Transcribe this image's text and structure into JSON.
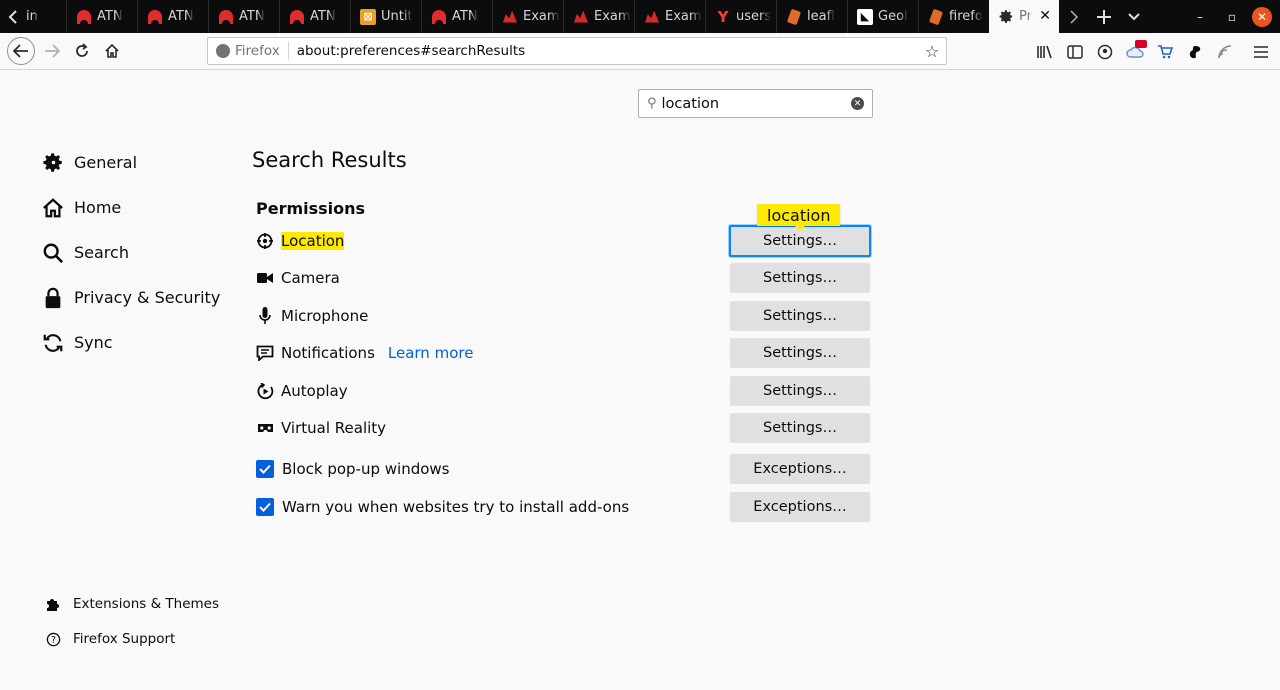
{
  "tabs": [
    {
      "label": "in",
      "icon": "chevron-left-icon"
    },
    {
      "label": "ATN",
      "icon": "huawei-icon"
    },
    {
      "label": "ATN",
      "icon": "huawei-icon"
    },
    {
      "label": "ATN",
      "icon": "huawei-icon"
    },
    {
      "label": "ATN",
      "icon": "huawei-icon"
    },
    {
      "label": "Untit",
      "icon": "untitled-icon"
    },
    {
      "label": "ATN",
      "icon": "huawei-icon"
    },
    {
      "label": "Exam",
      "icon": "exam-icon"
    },
    {
      "label": "Exam",
      "icon": "exam-icon"
    },
    {
      "label": "Exam",
      "icon": "exam-icon"
    },
    {
      "label": "users",
      "icon": "y-icon"
    },
    {
      "label": "leafl",
      "icon": "leaf-icon"
    },
    {
      "label": "Geol",
      "icon": "geo-icon"
    },
    {
      "label": "firefo",
      "icon": "leaf-icon"
    },
    {
      "label": "Pr",
      "icon": "gear-icon"
    }
  ],
  "urlbar": {
    "identity": "Firefox",
    "url": "about:preferences#searchResults"
  },
  "search": {
    "value": "location"
  },
  "sidebar": {
    "items": [
      {
        "label": "General",
        "icon": "gear-icon"
      },
      {
        "label": "Home",
        "icon": "home-icon"
      },
      {
        "label": "Search",
        "icon": "search-icon"
      },
      {
        "label": "Privacy & Security",
        "icon": "lock-icon"
      },
      {
        "label": "Sync",
        "icon": "sync-icon"
      }
    ],
    "footer": [
      {
        "label": "Extensions & Themes",
        "icon": "puzzle-icon"
      },
      {
        "label": "Firefox Support",
        "icon": "help-icon"
      }
    ]
  },
  "main": {
    "title": "Search Results",
    "section": "Permissions",
    "tooltip": "location",
    "rows": [
      {
        "label": "Location",
        "icon": "location-icon",
        "button": "Settings…"
      },
      {
        "label": "Camera",
        "icon": "camera-icon",
        "button": "Settings…"
      },
      {
        "label": "Microphone",
        "icon": "microphone-icon",
        "button": "Settings…"
      },
      {
        "label": "Notifications",
        "icon": "notifications-icon",
        "button": "Settings…",
        "link": "Learn more"
      },
      {
        "label": "Autoplay",
        "icon": "autoplay-icon",
        "button": "Settings…"
      },
      {
        "label": "Virtual Reality",
        "icon": "vr-icon",
        "button": "Settings…"
      }
    ],
    "checks": [
      {
        "label": "Block pop-up windows",
        "checked": true,
        "button": "Exceptions…"
      },
      {
        "label": "Warn you when websites try to install add-ons",
        "checked": true,
        "button": "Exceptions…"
      }
    ]
  },
  "colors": {
    "accent": "#0a84ff",
    "highlight": "#ffe900",
    "link": "#0060df"
  }
}
